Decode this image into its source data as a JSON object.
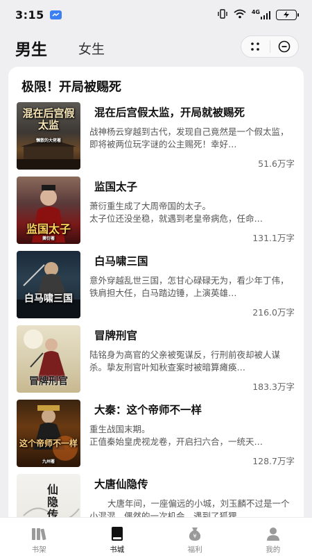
{
  "status_bar": {
    "time": "3:15",
    "network": "4G"
  },
  "top_tabs": {
    "male": "男生",
    "female": "女生",
    "active": "male"
  },
  "section": {
    "title": "极限！开局被赐死"
  },
  "books": [
    {
      "title": "混在后宫假太监，开局就被赐死",
      "desc": "战神杨云穿越到古代，发现自己竟然是一个假太监，即将被两位玩字谜的公主赐死！幸好…",
      "words": "51.6万字",
      "cover_text": "混在后宫假太监",
      "cover_author": "懒散的大佬著"
    },
    {
      "title": "监国太子",
      "desc": "萧衍重生成了大周帝国的太子。\n太子位还没坐稳，就遇到老皇帝病危，任命…",
      "words": "131.1万字",
      "cover_text": "监国太子",
      "cover_author": "萧衍著"
    },
    {
      "title": "白马啸三国",
      "desc": "意外穿越乱世三国，怎甘心碌碌无为，看少年丁伟，铁肩担大任，白马踏边锤，上演英雄…",
      "words": "216.0万字",
      "cover_text": "白马啸三国",
      "cover_author": ""
    },
    {
      "title": "冒牌刑官",
      "desc": "陆铭身为高官的父亲被冤谋反，行刑前夜却被人谋杀。挚友刑官叶知秋查案时被暗算瘫痪…",
      "words": "183.3万字",
      "cover_text": "冒牌刑官",
      "cover_author": ""
    },
    {
      "title": "大秦：这个帝师不一样",
      "desc": "重生战国末期。\n正值秦始皇虎视龙卷，开启扫六合，一统天…",
      "words": "128.7万字",
      "cover_text": "这个帝师不一样",
      "cover_author": "九州著"
    },
    {
      "title": "大唐仙隐传",
      "desc": "大唐年间，一座偏远的小城，刘玉麟不过是一个小混混，偶然的一次机会，遇到了狐狸…",
      "words": "",
      "cover_text": "仙隐传",
      "cover_author": ""
    }
  ],
  "bottom_nav": [
    {
      "label": "书架",
      "icon": "bookshelf-icon",
      "active": false
    },
    {
      "label": "书城",
      "icon": "book-icon",
      "active": true
    },
    {
      "label": "福利",
      "icon": "money-bag-icon",
      "active": false
    },
    {
      "label": "我的",
      "icon": "person-icon",
      "active": false
    }
  ],
  "colors": {
    "background": "#efeff1",
    "card": "#ffffff",
    "text_primary": "#111111",
    "text_secondary": "#555555",
    "status_accent": "#3b7ff2"
  }
}
